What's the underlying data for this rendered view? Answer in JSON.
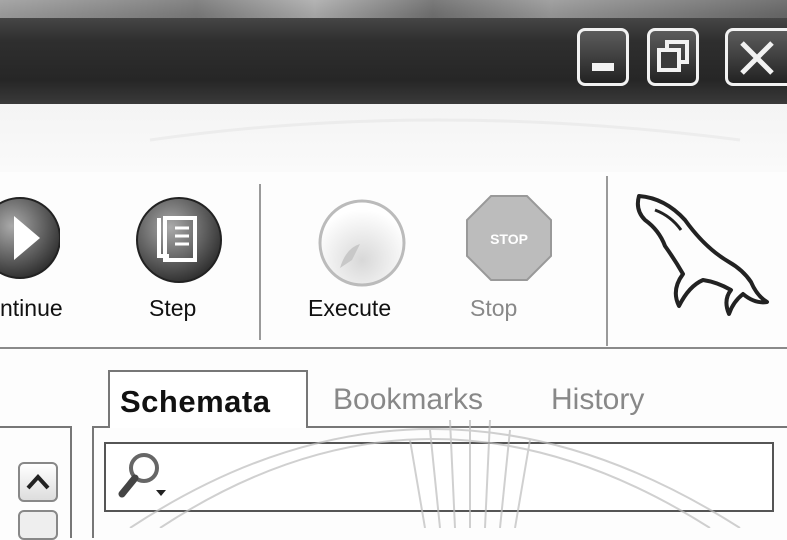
{
  "window": {
    "controls": {
      "minimize_icon": "minimize-icon",
      "restore_icon": "restore-icon",
      "close_icon": "close-icon"
    }
  },
  "toolbar": {
    "continue_label": "ntinue",
    "step_label": "Step",
    "execute_label": "Execute",
    "stop_label": "Stop",
    "stop_sign_text": "STOP"
  },
  "tabs": {
    "items": [
      {
        "label": "Schemata",
        "active": true
      },
      {
        "label": "Bookmarks",
        "active": false
      },
      {
        "label": "History",
        "active": false
      }
    ]
  },
  "search": {
    "icon": "search-icon",
    "value": ""
  },
  "colors": {
    "titlebar": "#2f2f2f",
    "background": "#fdfdfd",
    "disabled_text": "#888888"
  }
}
